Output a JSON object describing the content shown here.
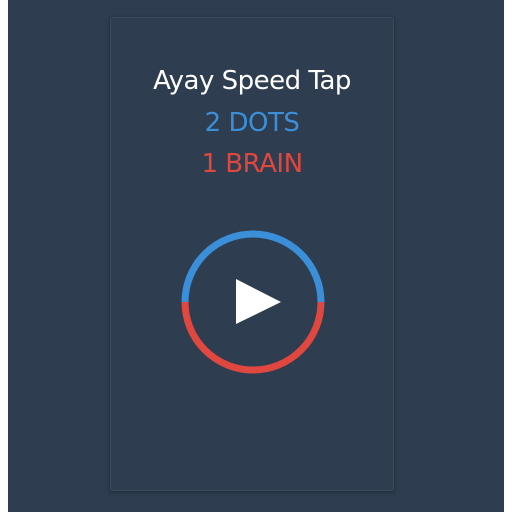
{
  "game": {
    "title": "Ayay Speed Tap",
    "line2": "2 DOTS",
    "line3": "1 BRAIN"
  },
  "colors": {
    "background": "#2e3d50",
    "title": "#ffffff",
    "blue": "#3b8fd9",
    "red": "#e0473e",
    "play_triangle": "#ffffff"
  },
  "play_button": {
    "icon": "play-icon"
  }
}
